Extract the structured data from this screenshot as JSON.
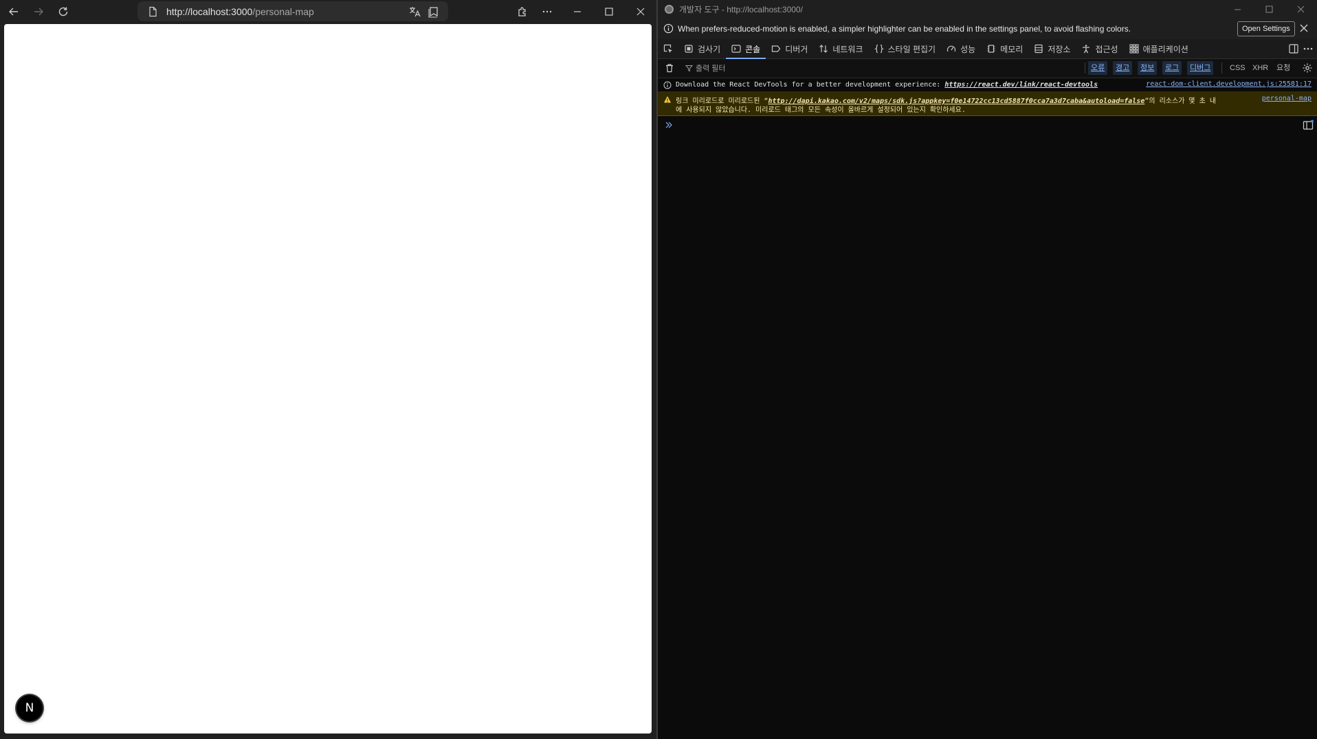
{
  "browser": {
    "url_host": "http://localhost:3000",
    "url_path": "/personal-map",
    "nextjs_badge": "N"
  },
  "devtools": {
    "title": "개발자 도구 - http://localhost:3000/",
    "infobar": {
      "message": "When prefers-reduced-motion is enabled, a simpler highlighter can be enabled in the settings panel, to avoid flashing colors.",
      "button": "Open Settings"
    },
    "tabs": [
      {
        "label": "검사기",
        "icon": "inspector-icon"
      },
      {
        "label": "콘솔",
        "icon": "console-icon",
        "active": true
      },
      {
        "label": "디버거",
        "icon": "debugger-icon"
      },
      {
        "label": "네트워크",
        "icon": "network-icon"
      },
      {
        "label": "스타일 편집기",
        "icon": "style-editor-icon"
      },
      {
        "label": "성능",
        "icon": "performance-icon"
      },
      {
        "label": "메모리",
        "icon": "memory-icon"
      },
      {
        "label": "저장소",
        "icon": "storage-icon"
      },
      {
        "label": "접근성",
        "icon": "accessibility-icon"
      },
      {
        "label": "애플리케이션",
        "icon": "application-icon"
      }
    ],
    "filter": {
      "placeholder": "출력 필터",
      "levels": [
        "오류",
        "경고",
        "정보",
        "로그",
        "디버그"
      ],
      "request_types": [
        "CSS",
        "XHR",
        "요청"
      ]
    },
    "messages": {
      "info": {
        "text": "Download the React DevTools for a better development experience: ",
        "link": "https://react.dev/link/react-devtools",
        "source": "react-dom-client.development.js:25581:17"
      },
      "warning": {
        "prefix": "링크 미리로드로 미리로드된 “",
        "link": "http://dapi.kakao.com/v2/maps/sdk.js?appkey=f0e14722cc13cd5887f0cca7a3d7caba&autoload=false",
        "suffix": "”의 리소스가 몇 초 내",
        "line2": "에 사용되지 않았습니다. 미리로드 태그의 모든 속성이 올바르게 설정되어 있는지 확인하세요.",
        "source": "personal-map"
      }
    }
  },
  "colors": {
    "accent": "#7cacf8",
    "link": "#8ab4f8",
    "warning_bg": "#332b00",
    "warning_text": "#f2e6b1",
    "devtools_bg": "#0b0b0b"
  }
}
